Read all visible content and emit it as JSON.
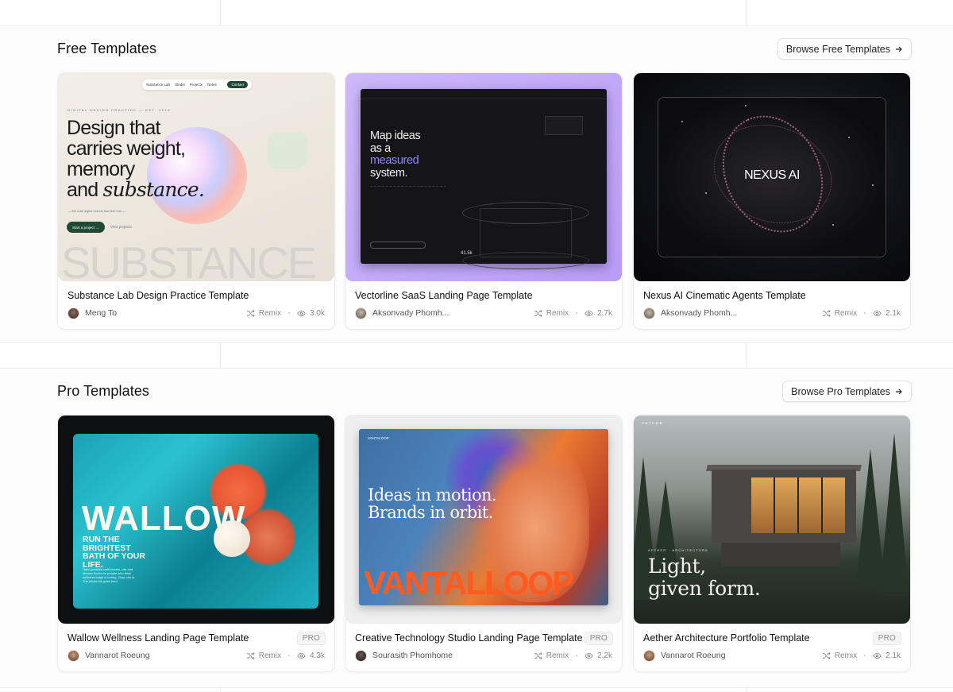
{
  "free": {
    "title": "Free Templates",
    "browse_label": "Browse Free Templates",
    "cards": [
      {
        "title": "Substance Lab Design Practice Template",
        "author": "Meng To",
        "remix": "Remix",
        "views": "3.0k",
        "thumb": {
          "nav_brand": "Substance Lab",
          "nav_links": [
            "Studio",
            "Projects",
            "Notes"
          ],
          "nav_cta": "Contact",
          "eyebrow": "DIGITAL DESIGN PRACTICE — EST. 2018",
          "hero_lines": [
            "Design that",
            "carries weight,",
            "memory"
          ],
          "hero_and": "and ",
          "hero_italic": "substance.",
          "small": "— We craft digital brands that feel real —",
          "cta": "Start a project →",
          "cta2": "View projects",
          "big_word": "SUBSTANCE"
        }
      },
      {
        "title": "Vectorline SaaS Landing Page Template",
        "author": "Aksonvady Phomh...",
        "remix": "Remix",
        "views": "2.7k",
        "thumb": {
          "hero_lines": [
            "Map ideas",
            "as a"
          ],
          "hero_hl": "measured",
          "hero_end": "system.",
          "stat": "41.5k"
        }
      },
      {
        "title": "Nexus AI Cinematic Agents Template",
        "author": "Aksonvady Phomh...",
        "remix": "Remix",
        "views": "2.1k",
        "thumb": {
          "label": "NEXUS AI"
        }
      }
    ]
  },
  "pro": {
    "title": "Pro Templates",
    "browse_label": "Browse Pro Templates",
    "badge": "PRO",
    "cards": [
      {
        "title": "Wallow Wellness Landing Page Template",
        "author": "Vannarot Roeung",
        "remix": "Remix",
        "views": "4.3k",
        "thumb": {
          "word": "WALLOW",
          "sub_lines": [
            "RUN THE",
            "BRIGHTEST",
            "BATH OF YOUR",
            "LIFE."
          ],
          "tiny": "Hand-pressed bath bombs, oils and shower fizzes for people who think wellness lodge is boring. Drop one in. The whole tub goes loud."
        }
      },
      {
        "title": "Creative Technology Studio Landing Page Template",
        "author": "Sourasith Phomhome",
        "remix": "Remix",
        "views": "2.2k",
        "thumb": {
          "top": "VANTALOOP",
          "hero_lines": [
            "Ideas in motion.",
            "Brands in orbit."
          ],
          "brand": "VANTALLOOP"
        }
      },
      {
        "title": "Aether Architecture Portfolio Template",
        "author": "Vannarot Roeung",
        "remix": "Remix",
        "views": "2.1k",
        "thumb": {
          "top": "AETHER",
          "eyebrow": "AETHER · ARCHITECTURE",
          "hero_lines": [
            "Light,",
            "given form."
          ]
        }
      }
    ]
  },
  "colors": {
    "substance_green": "#1f4a35",
    "vectorline_purple": "#b79df7",
    "vantaloop_orange": "#ff5a1f",
    "pro_badge_bg": "#f4f4f5"
  },
  "icons": {
    "arrow": "arrow-right-icon",
    "remix": "shuffle-icon",
    "views": "eye-icon"
  }
}
